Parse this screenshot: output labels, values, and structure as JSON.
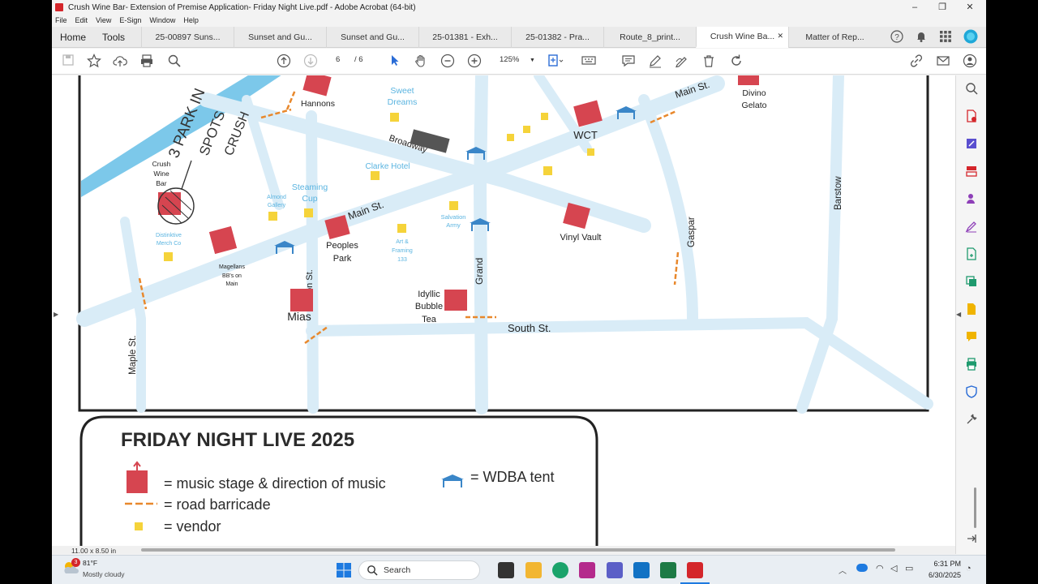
{
  "window": {
    "title": "Crush Wine Bar- Extension of Premise Application- Friday Night Live.pdf - Adobe Acrobat (64-bit)",
    "minimize": "–",
    "maximize": "❐",
    "close": "✕"
  },
  "menu": [
    "File",
    "Edit",
    "View",
    "E-Sign",
    "Window",
    "Help"
  ],
  "tabs": {
    "home": "Home",
    "tools": "Tools",
    "documents": [
      {
        "label": "25-00897 Suns..."
      },
      {
        "label": "Sunset and Gu..."
      },
      {
        "label": "Sunset and Gu..."
      },
      {
        "label": "25-01381 - Exh..."
      },
      {
        "label": "25-01382 - Pra..."
      },
      {
        "label": "Route_8_print..."
      },
      {
        "label": "Crush Wine Ba..."
      },
      {
        "label": "Matter of Rep..."
      }
    ],
    "active_close": "✕"
  },
  "toolbar": {
    "page_current": "6",
    "page_total": "/ 6",
    "zoom": "125%"
  },
  "page_size": "11.00 x 8.50 in",
  "map": {
    "streets": {
      "main_st_1": "Main St.",
      "main_st_2": "Main St.",
      "broadway": "Broadway",
      "grand": "Grand",
      "south_st": "South St.",
      "gaspar": "Gaspar",
      "barstow": "Barstow",
      "maple_st": "Maple St.",
      "clinton_st": "Clinton St."
    },
    "places": {
      "hannons": "Hannons",
      "sweet_dreams_1": "Sweet",
      "sweet_dreams_2": "Dreams",
      "wct": "WCT",
      "divino_1": "Divino",
      "divino_2": "Gelato",
      "crush_1": "Crush",
      "crush_2": "Wine",
      "crush_3": "Bar",
      "clarke_hotel": "Clarke Hotel",
      "steaming_1": "Steaming",
      "steaming_2": "Cup",
      "almond_1": "Almond",
      "almond_2": "Gallery",
      "distinktive_1": "Distinktive",
      "distinktive_2": "Merch Co",
      "magellans": "Magellans",
      "bbs_1": "BB's on",
      "bbs_2": "Main",
      "peoples_1": "Peoples",
      "peoples_2": "Park",
      "salvation_1": "Salvation",
      "salvation_2": "Army",
      "art_1": "Art &",
      "art_2": "Framing",
      "art_3": "133",
      "vinyl_vault": "Vinyl Vault",
      "idyllic_1": "Idyllic",
      "idyllic_2": "Bubble",
      "idyllic_3": "Tea",
      "mias": "Mias"
    },
    "handwriting": [
      "3 PARK IN",
      "SPOTS",
      "CRUSH"
    ]
  },
  "legend": {
    "title": "FRIDAY NIGHT LIVE 2025",
    "music": "= music stage & direction of music",
    "tent": "= WDBA tent",
    "barricade": "= road barricade",
    "vendor": "= vendor"
  },
  "taskbar": {
    "temp": "81°F",
    "weather": "Mostly cloudy",
    "notif": "3",
    "search": "Search",
    "time": "6:31 PM",
    "date": "6/30/2025"
  },
  "colors": {
    "stage": "#d64550",
    "tent": "#3a86c8",
    "vendor": "#f5d33a",
    "barricade": "#e8882c",
    "street": "#d9ecf7",
    "river": "#7cc8ea"
  }
}
